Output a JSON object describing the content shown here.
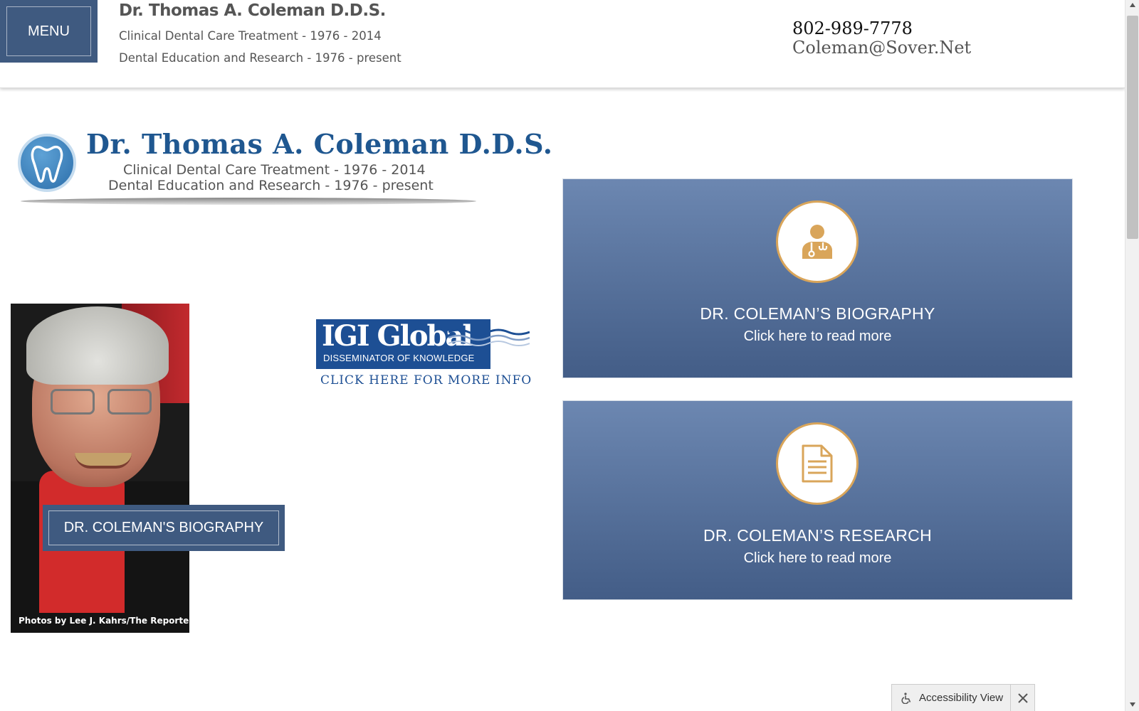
{
  "header": {
    "menu_label": "MENU",
    "site_title": "Dr. Thomas A. Coleman D.D.S.",
    "subtitle_1": "Clinical Dental Care Treatment - 1976 - 2014",
    "subtitle_2": "Dental Education and Research - 1976 - present",
    "phone": "802-989-7778",
    "email": "Coleman@Sover.Net"
  },
  "logo": {
    "name": "Dr. Thomas A. Coleman D.D.S.",
    "line_1": "Clinical Dental Care Treatment - 1976 - 2014",
    "line_2": "Dental Education and Research - 1976 - present",
    "icon": "tooth-icon"
  },
  "photo": {
    "credit": "Photos by Lee J. Kahrs/The Reporter",
    "button_label": "DR. COLEMAN'S BIOGRAPHY"
  },
  "igi": {
    "name": "IGI Global",
    "tagline": "DISSEMINATOR OF KNOWLEDGE",
    "link_text": "CLICK HERE FOR MORE INFO"
  },
  "cards": [
    {
      "title": "DR. COLEMAN’S BIOGRAPHY",
      "subtitle": "Click here to read more",
      "icon": "doctor-icon"
    },
    {
      "title": "DR. COLEMAN’S RESEARCH",
      "subtitle": "Click here to read more",
      "icon": "document-icon"
    }
  ],
  "accessibility": {
    "label": "Accessibility View",
    "icon": "wheelchair-icon",
    "close_icon": "close-icon"
  },
  "colors": {
    "brand_blue": "#3f5a80",
    "card_top": "#6c87b1",
    "card_bottom": "#435d87",
    "accent_gold": "#d9a55a",
    "logo_blue": "#1f5790",
    "igi_blue": "#1d4f94"
  }
}
